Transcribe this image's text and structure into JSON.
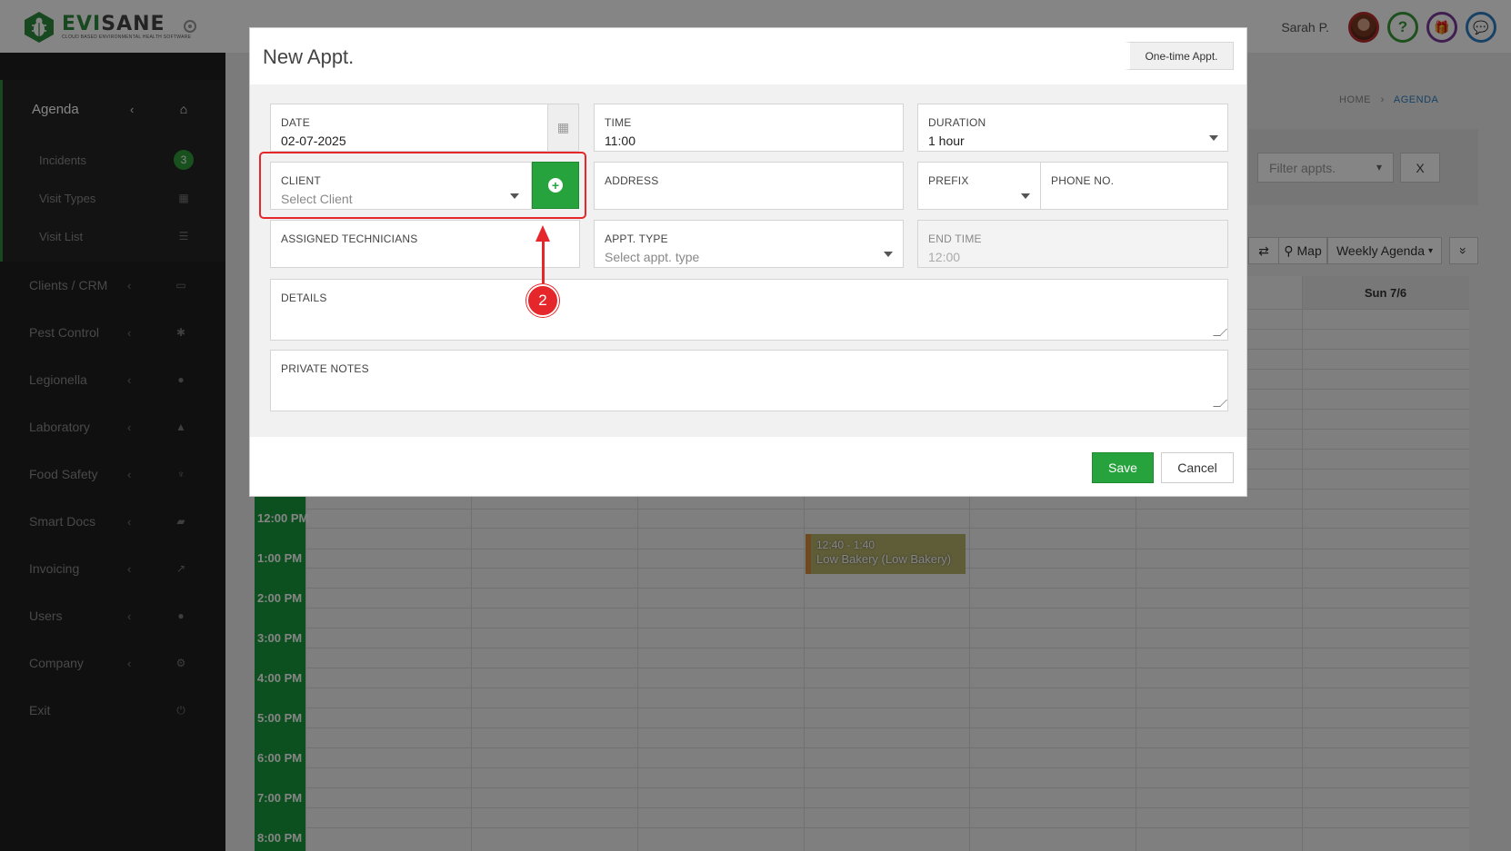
{
  "brand": {
    "name_green": "EVI",
    "name_gray": "SANE",
    "tagline": "CLOUD BASED ENVIRONMENTAL HEALTH SOFTWARE"
  },
  "user": {
    "name": "Sarah P."
  },
  "sidebar": {
    "agenda": {
      "label": "Agenda",
      "chev": "‹"
    },
    "sub_items": [
      {
        "label": "Incidents",
        "badge": "3"
      },
      {
        "label": "Visit Types"
      },
      {
        "label": "Visit List"
      }
    ],
    "items": [
      {
        "label": "Clients / CRM"
      },
      {
        "label": "Pest Control"
      },
      {
        "label": "Legionella"
      },
      {
        "label": "Laboratory"
      },
      {
        "label": "Food Safety"
      },
      {
        "label": "Smart Docs"
      },
      {
        "label": "Invoicing"
      },
      {
        "label": "Users"
      },
      {
        "label": "Company"
      },
      {
        "label": "Exit"
      }
    ]
  },
  "breadcrumb": {
    "home": "HOME",
    "sep": "›",
    "current": "AGENDA"
  },
  "filters": {
    "placeholder": "Filter appts.",
    "clear": "X"
  },
  "toolbar": {
    "swap": "⇄",
    "map": "Map",
    "view": "Weekly Agenda",
    "more": "»"
  },
  "calendar": {
    "header_day": "Sun 7/6",
    "times": [
      "12:00 PM",
      "1:00 PM",
      "2:00 PM",
      "3:00 PM",
      "4:00 PM",
      "5:00 PM",
      "6:00 PM",
      "7:00 PM",
      "8:00 PM"
    ],
    "event": {
      "time": "12:40 - 1:40",
      "name": "Low Bakery (Low Bakery)"
    }
  },
  "modal": {
    "title": "New Appt.",
    "one_time_label": "One-time Appt.",
    "fields": {
      "date": {
        "label": "DATE",
        "value": "02-07-2025"
      },
      "time": {
        "label": "TIME",
        "value": "11:00"
      },
      "duration": {
        "label": "DURATION",
        "value": "1 hour"
      },
      "client": {
        "label": "CLIENT",
        "placeholder": "Select Client"
      },
      "address": {
        "label": "ADDRESS"
      },
      "prefix": {
        "label": "PREFIX"
      },
      "phone": {
        "label": "PHONE NO."
      },
      "technicians": {
        "label": "ASSIGNED TECHNICIANS"
      },
      "appt_type": {
        "label": "APPT. TYPE",
        "placeholder": "Select appt. type"
      },
      "end_time": {
        "label": "END TIME",
        "value": "12:00"
      },
      "details": {
        "label": "DETAILS"
      },
      "private_notes": {
        "label": "PRIVATE NOTES"
      }
    },
    "save": "Save",
    "cancel": "Cancel"
  },
  "annotation": {
    "step": "2"
  },
  "colors": {
    "brand_green": "#26a33c",
    "annotation_red": "#e5262a",
    "link_blue": "#2e7fc2"
  }
}
